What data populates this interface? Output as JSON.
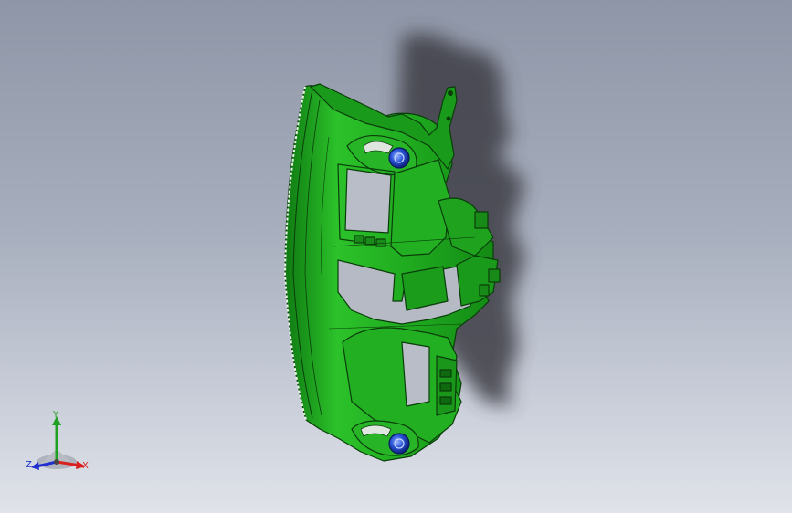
{
  "view": {
    "background_top": "#8f96a7",
    "background_bottom": "#e0e3e9",
    "part_color": "#1ea81e",
    "part_edge_color": "#0a3d0a",
    "accent_blue": "#2a55d8",
    "shadow_color": "#3c3e44"
  },
  "triad": {
    "x_label": "X",
    "y_label": "Y",
    "z_label": "Z",
    "x_color": "#d82020",
    "y_color": "#20a020",
    "z_color": "#2030d0"
  }
}
